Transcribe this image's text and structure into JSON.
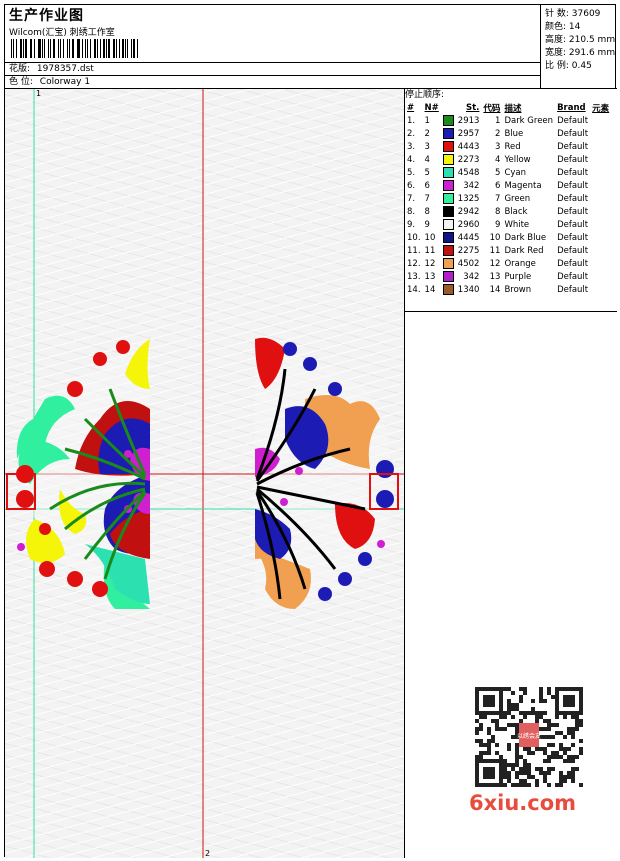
{
  "header": {
    "title": "生产作业图",
    "company": "Wilcom(汇宝) 刺绣工作室",
    "design_label": "花版:",
    "design_file": "1978357.dst",
    "colorway_label": "色 位:",
    "colorway": "Colorway 1"
  },
  "stats": [
    {
      "label": "针 数:",
      "value": "37609"
    },
    {
      "label": "颜色:",
      "value": "14"
    },
    {
      "label": "高度:",
      "value": "210.5 mm"
    },
    {
      "label": "宽度:",
      "value": "291.6 mm"
    },
    {
      "label": "比 例:",
      "value": "0.45"
    }
  ],
  "stop_sequence_label": "停止顺序:",
  "table_headers": {
    "num": "#",
    "needle": "N#",
    "stitches": "St.",
    "code": "代码",
    "desc": "描述",
    "brand": "Brand",
    "element": "元素"
  },
  "colors": [
    {
      "num": "1.",
      "needle": "1",
      "swatch": "#1a8a1a",
      "stitches": "2913",
      "code": "1",
      "desc": "Dark Green",
      "brand": "Default"
    },
    {
      "num": "2.",
      "needle": "2",
      "swatch": "#1c1cb4",
      "stitches": "2957",
      "code": "2",
      "desc": "Blue",
      "brand": "Default"
    },
    {
      "num": "3.",
      "needle": "3",
      "swatch": "#e01010",
      "stitches": "4443",
      "code": "3",
      "desc": "Red",
      "brand": "Default"
    },
    {
      "num": "4.",
      "needle": "4",
      "swatch": "#f5f50a",
      "stitches": "2273",
      "code": "4",
      "desc": "Yellow",
      "brand": "Default"
    },
    {
      "num": "5.",
      "needle": "5",
      "swatch": "#2ce0b0",
      "stitches": "4548",
      "code": "5",
      "desc": "Cyan",
      "brand": "Default"
    },
    {
      "num": "6.",
      "needle": "6",
      "swatch": "#d01fd0",
      "stitches": "342",
      "code": "6",
      "desc": "Magenta",
      "brand": "Default"
    },
    {
      "num": "7.",
      "needle": "7",
      "swatch": "#30f0a0",
      "stitches": "1325",
      "code": "7",
      "desc": "Green",
      "brand": "Default"
    },
    {
      "num": "8.",
      "needle": "8",
      "swatch": "#000000",
      "stitches": "2942",
      "code": "8",
      "desc": "Black",
      "brand": "Default"
    },
    {
      "num": "9.",
      "needle": "9",
      "swatch": "#f4f4f4",
      "stitches": "2960",
      "code": "9",
      "desc": "White",
      "brand": "Default"
    },
    {
      "num": "10.",
      "needle": "10",
      "swatch": "#12128a",
      "stitches": "4445",
      "code": "10",
      "desc": "Dark Blue",
      "brand": "Default"
    },
    {
      "num": "11.",
      "needle": "11",
      "swatch": "#c01010",
      "stitches": "2275",
      "code": "11",
      "desc": "Dark Red",
      "brand": "Default"
    },
    {
      "num": "12.",
      "needle": "12",
      "swatch": "#f0a050",
      "stitches": "4502",
      "code": "12",
      "desc": "Orange",
      "brand": "Default"
    },
    {
      "num": "13.",
      "needle": "13",
      "swatch": "#b020c8",
      "stitches": "342",
      "code": "13",
      "desc": "Purple",
      "brand": "Default"
    },
    {
      "num": "14.",
      "needle": "14",
      "swatch": "#9a5a2a",
      "stitches": "1340",
      "code": "14",
      "desc": "Brown",
      "brand": "Default"
    }
  ],
  "guides": {
    "label_1": "1",
    "label_2": "2"
  },
  "watermark": "6xiu.com",
  "seal_text": "以绣会友"
}
